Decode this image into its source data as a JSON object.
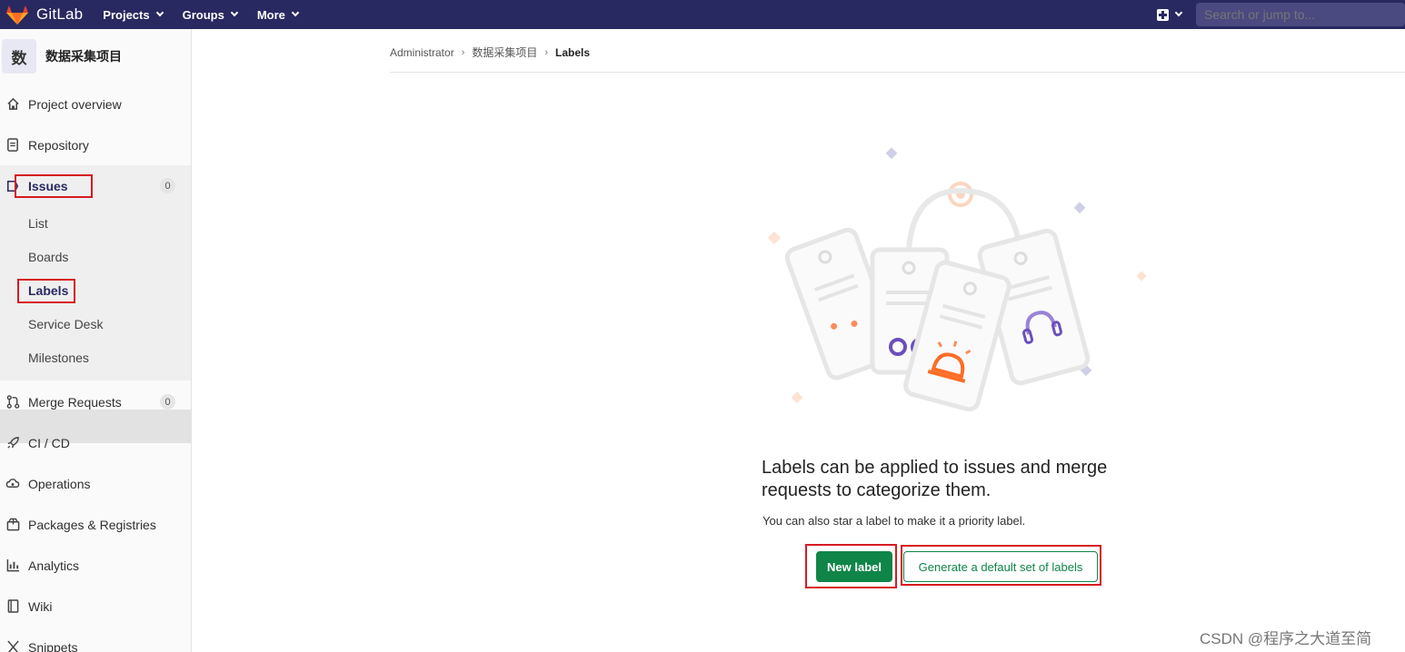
{
  "navbar": {
    "brand": "GitLab",
    "menu": [
      {
        "label": "Projects"
      },
      {
        "label": "Groups"
      },
      {
        "label": "More"
      }
    ],
    "search_placeholder": "Search or jump to..."
  },
  "sidebar": {
    "project_avatar": "数",
    "project_name": "数据采集项目",
    "items": {
      "overview": "Project overview",
      "repository": "Repository",
      "issues": "Issues",
      "issues_count": "0",
      "issues_sub": [
        "List",
        "Boards",
        "Labels",
        "Service Desk",
        "Milestones"
      ],
      "merge_requests": "Merge Requests",
      "merge_requests_count": "0",
      "cicd": "CI / CD",
      "operations": "Operations",
      "packages": "Packages & Registries",
      "analytics": "Analytics",
      "wiki": "Wiki",
      "snippets": "Snippets"
    }
  },
  "breadcrumb": [
    "Administrator",
    "数据采集项目",
    "Labels"
  ],
  "empty_state": {
    "title": "Labels can be applied to issues and merge requests to categorize them.",
    "description": "You can also star a label to make it a priority label.",
    "new_label_button": "New label",
    "generate_button": "Generate a default set of labels"
  },
  "watermark": "CSDN @程序之大道至简",
  "colors": {
    "navbar": "#292961",
    "primary_green": "#108548",
    "annotation_red": "#d71a21"
  }
}
